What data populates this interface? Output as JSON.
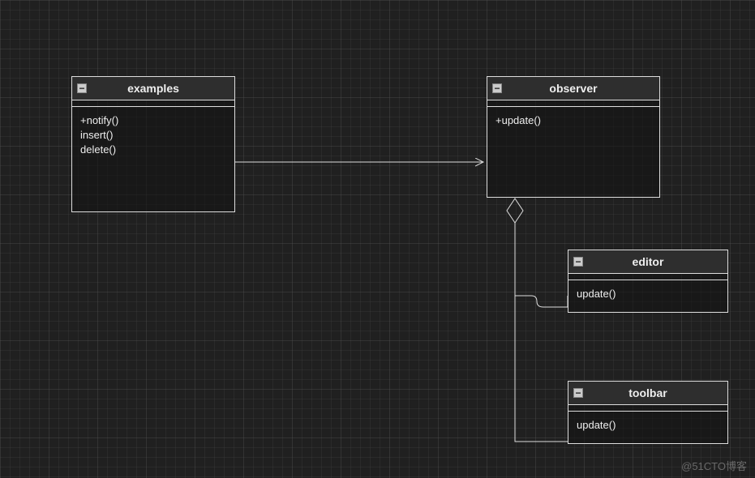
{
  "watermark": "@51CTO博客",
  "classes": {
    "examples": {
      "title": "examples",
      "methods": [
        "+notify()",
        "insert()",
        "delete()"
      ]
    },
    "observer": {
      "title": "observer",
      "methods": [
        "+update()"
      ]
    },
    "editor": {
      "title": "editor",
      "methods": [
        "update()"
      ]
    },
    "toolbar": {
      "title": "toolbar",
      "methods": [
        "update()"
      ]
    }
  },
  "relations": [
    {
      "from": "examples",
      "to": "observer",
      "type": "association-arrow"
    },
    {
      "from": "observer",
      "to": "editor",
      "type": "aggregation"
    },
    {
      "from": "observer",
      "to": "toolbar",
      "type": "aggregation"
    }
  ]
}
